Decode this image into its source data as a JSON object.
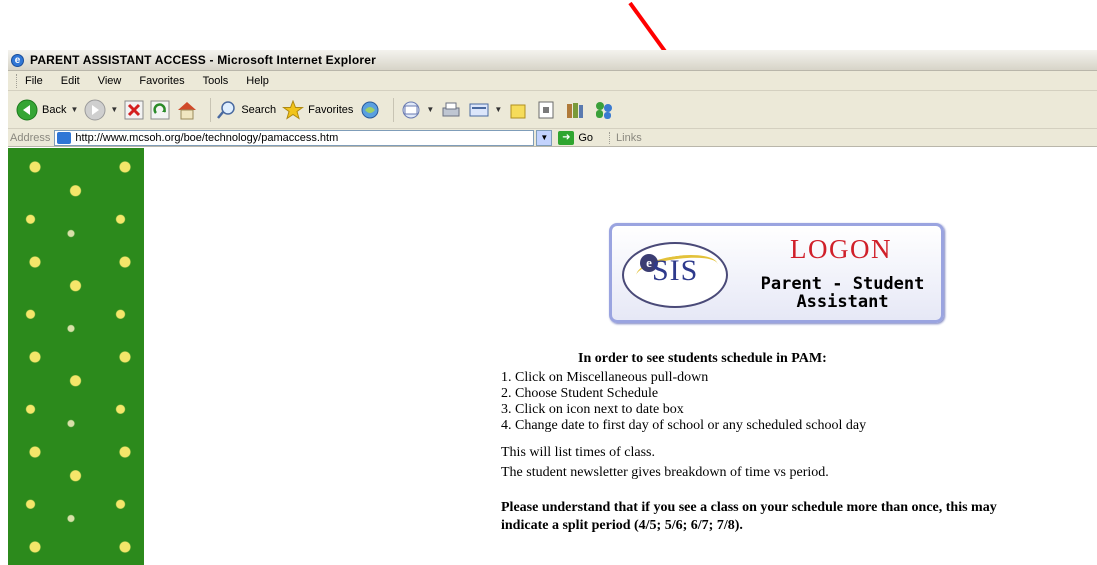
{
  "window": {
    "title": "PARENT ASSISTANT ACCESS - Microsoft Internet Explorer"
  },
  "menu": [
    "File",
    "Edit",
    "View",
    "Favorites",
    "Tools",
    "Help"
  ],
  "toolbar": {
    "back_label": "Back",
    "search_label": "Search",
    "favorites_label": "Favorites"
  },
  "address": {
    "label": "Address",
    "url": "http://www.mcsoh.org/boe/technology/pamaccess.htm",
    "go_label": "Go",
    "links_label": "Links"
  },
  "logon": {
    "brand": "SIS",
    "brand_prefix": "e",
    "title": "LOGON",
    "subtitle_line1": "Parent - Student",
    "subtitle_line2": "Assistant"
  },
  "instructions": {
    "heading": "In order to see students schedule in PAM:",
    "steps": [
      "1. Click on Miscellaneous pull-down",
      "2. Choose Student Schedule",
      "3. Click on icon next to date box",
      "4. Change date to first day of school or any scheduled school day"
    ],
    "note1": "This will list times of class.",
    "note2": "The student newsletter gives breakdown of time vs period.",
    "warning": "Please understand that if you see a class on your schedule more than once, this may indicate a split period (4/5; 5/6; 6/7; 7/8)."
  },
  "colors": {
    "annotation_arrow": "#ff0000",
    "logon_title": "#d0202a",
    "sidebar_green": "#2c8a1c"
  }
}
